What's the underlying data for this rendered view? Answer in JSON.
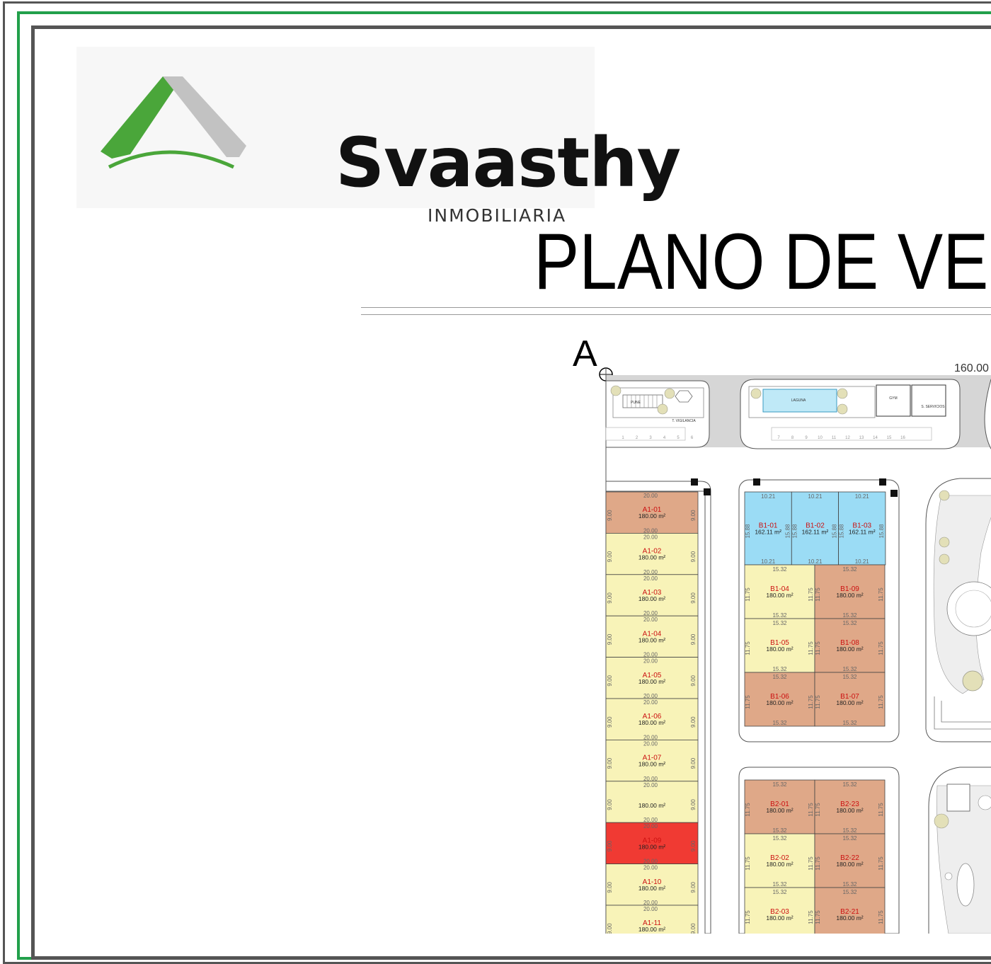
{
  "brand": {
    "name": "Svaasthy",
    "subtitle": "INMOBILIARIA",
    "colors": {
      "green": "#4aa63a",
      "gray": "#c2c2c2",
      "frame_green": "#22a04b"
    }
  },
  "title": "PLANO DE VE",
  "marker_point": "A",
  "top_dimension": "160.00",
  "amenities": {
    "labels": [
      "PUNE",
      "T. VIGILANCIA",
      "LAGUNA",
      "GYM",
      "S. SERVICIOS"
    ],
    "parking_numbers": [
      "1",
      "2",
      "3",
      "4",
      "5",
      "6",
      "7",
      "8",
      "9",
      "10",
      "11",
      "12",
      "13",
      "14",
      "15",
      "16"
    ]
  },
  "block_a": {
    "side_length": "9.00",
    "front_length": "20.00",
    "lots": [
      {
        "id": "A1-01",
        "area": "180.00 m²",
        "status": "reserved"
      },
      {
        "id": "A1-02",
        "area": "180.00 m²",
        "status": "available"
      },
      {
        "id": "A1-03",
        "area": "180.00 m²",
        "status": "available"
      },
      {
        "id": "A1-04",
        "area": "180.00 m²",
        "status": "available"
      },
      {
        "id": "A1-05",
        "area": "180.00 m²",
        "status": "available"
      },
      {
        "id": "A1-06",
        "area": "180.00 m²",
        "status": "available"
      },
      {
        "id": "A1-07",
        "area": "180.00 m²",
        "status": "available"
      },
      {
        "id": "",
        "area": "180.00 m²",
        "status": "available"
      },
      {
        "id": "A1-09",
        "area": "180.00 m²",
        "status": "sold"
      },
      {
        "id": "A1-10",
        "area": "180.00 m²",
        "status": "available"
      },
      {
        "id": "A1-11",
        "area": "180.00 m²",
        "status": "available"
      }
    ]
  },
  "block_b1_top": {
    "width": "10.21",
    "depth": "15.88",
    "lots": [
      {
        "id": "B1-01",
        "area": "162.11 m²"
      },
      {
        "id": "B1-02",
        "area": "162.11 m²"
      },
      {
        "id": "B1-03",
        "area": "162.11 m²"
      }
    ]
  },
  "block_b1": {
    "width": "15.32",
    "depth": "11.75",
    "rows": [
      [
        {
          "id": "B1-04",
          "area": "180.00 m²",
          "status": "available"
        },
        {
          "id": "B1-09",
          "area": "180.00 m²",
          "status": "reserved"
        }
      ],
      [
        {
          "id": "B1-05",
          "area": "180.00 m²",
          "status": "available"
        },
        {
          "id": "B1-08",
          "area": "180.00 m²",
          "status": "reserved"
        }
      ],
      [
        {
          "id": "B1-06",
          "area": "180.00 m²",
          "status": "reserved"
        },
        {
          "id": "B1-07",
          "area": "180.00 m²",
          "status": "reserved"
        }
      ]
    ]
  },
  "block_b2": {
    "width": "15.32",
    "depth": "11.75",
    "rows": [
      [
        {
          "id": "B2-01",
          "area": "180.00 m²",
          "status": "reserved"
        },
        {
          "id": "B2-23",
          "area": "180.00 m²",
          "status": "reserved"
        }
      ],
      [
        {
          "id": "B2-02",
          "area": "180.00 m²",
          "status": "available"
        },
        {
          "id": "B2-22",
          "area": "180.00 m²",
          "status": "reserved"
        }
      ],
      [
        {
          "id": "B2-03",
          "area": "180.00 m²",
          "status": "available"
        },
        {
          "id": "B2-21",
          "area": "180.00 m²",
          "status": "reserved"
        }
      ]
    ]
  },
  "status_colors": {
    "available": "#f8f3b8",
    "reserved": "#dfa888",
    "sold": "#f03a33",
    "premium": "#9bdcf5"
  }
}
